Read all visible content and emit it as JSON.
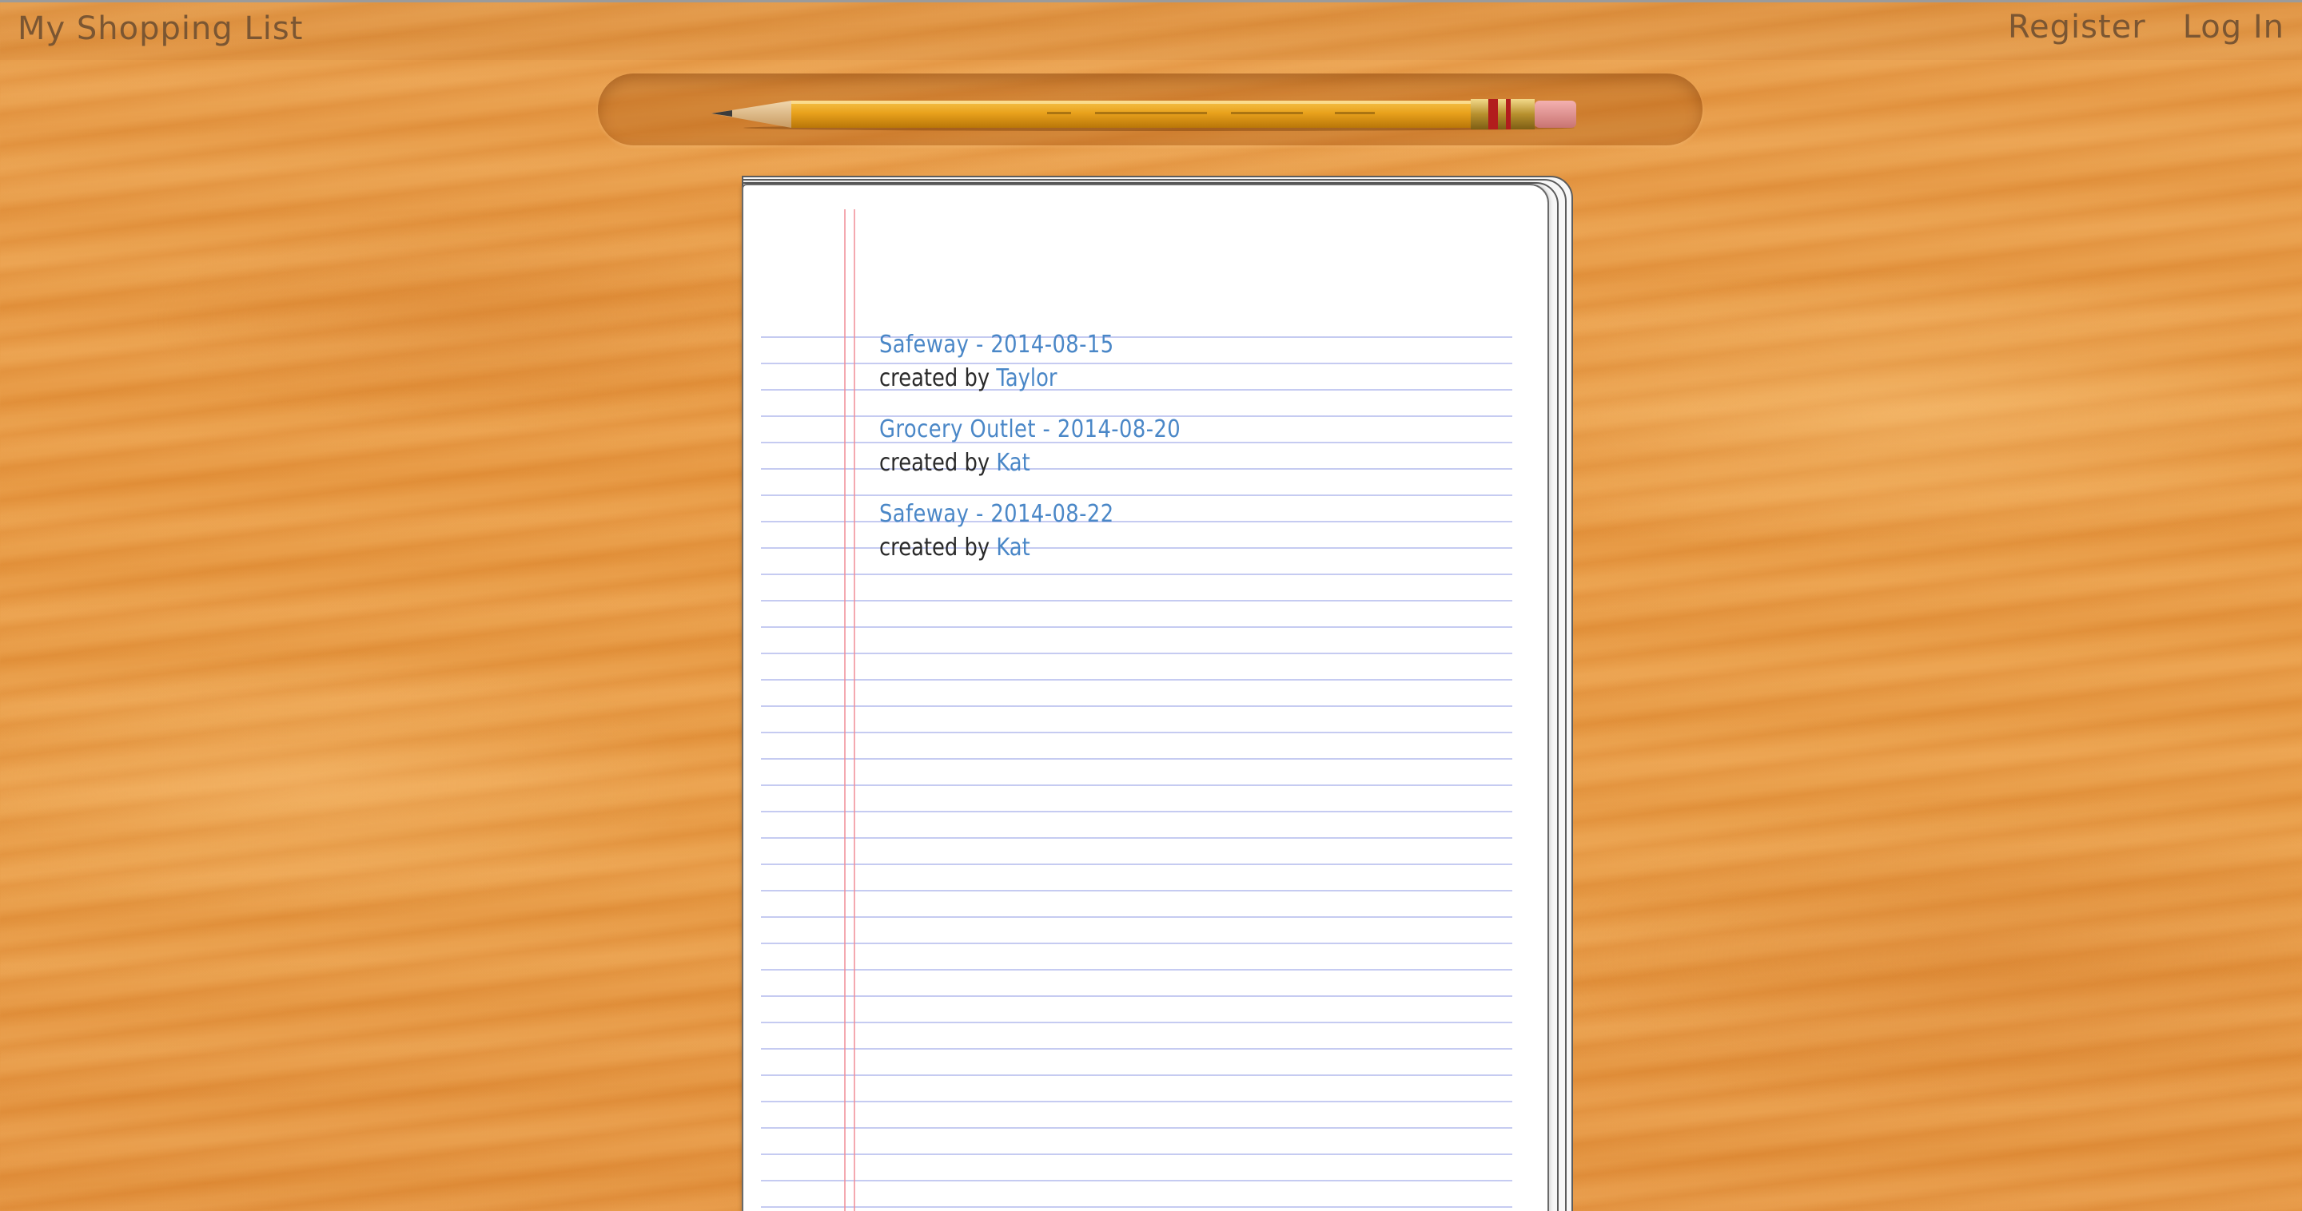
{
  "navbar": {
    "brand": "My Shopping List",
    "links": [
      {
        "label": "Register"
      },
      {
        "label": "Log In"
      }
    ]
  },
  "lists": [
    {
      "title": "Safeway - 2014-08-15",
      "created_by_label": "created by",
      "user": "Taylor"
    },
    {
      "title": "Grocery Outlet - 2014-08-20",
      "created_by_label": "created by",
      "user": "Kat"
    },
    {
      "title": "Safeway - 2014-08-22",
      "created_by_label": "created by",
      "user": "Kat"
    }
  ],
  "icons": {
    "pencil": "pencil-icon"
  },
  "colors": {
    "wood": "#e8963d",
    "nav_text": "#7b5632",
    "link": "#4a87c7",
    "rule_line": "#96a0e6",
    "margin_line": "#f08c96"
  }
}
